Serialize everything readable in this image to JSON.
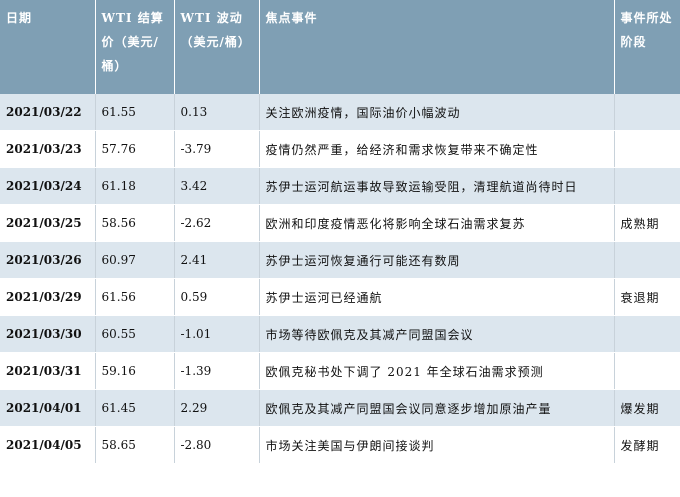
{
  "table": {
    "headers": [
      "日期",
      "WTI 结算价（美元/桶）",
      "WTI 波动（美元/桶）",
      "焦点事件",
      "事件所处阶段"
    ],
    "rows": [
      {
        "date": "2021/03/22",
        "price": "61.55",
        "change": "0.13",
        "event": "关注欧洲疫情，国际油价小幅波动",
        "phase": ""
      },
      {
        "date": "2021/03/23",
        "price": "57.76",
        "change": "-3.79",
        "event": "疫情仍然严重，给经济和需求恢复带来不确定性",
        "phase": ""
      },
      {
        "date": "2021/03/24",
        "price": "61.18",
        "change": "3.42",
        "event": "苏伊士运河航运事故导致运输受阻，清理航道尚待时日",
        "phase": ""
      },
      {
        "date": "2021/03/25",
        "price": "58.56",
        "change": "-2.62",
        "event": "欧洲和印度疫情恶化将影响全球石油需求复苏",
        "phase": "成熟期"
      },
      {
        "date": "2021/03/26",
        "price": "60.97",
        "change": "2.41",
        "event": "苏伊士运河恢复通行可能还有数周",
        "phase": ""
      },
      {
        "date": "2021/03/29",
        "price": "61.56",
        "change": "0.59",
        "event": "苏伊士运河已经通航",
        "phase": "衰退期"
      },
      {
        "date": "2021/03/30",
        "price": "60.55",
        "change": "-1.01",
        "event": "市场等待欧佩克及其减产同盟国会议",
        "phase": ""
      },
      {
        "date": "2021/03/31",
        "price": "59.16",
        "change": "-1.39",
        "event": "欧佩克秘书处下调了 2021 年全球石油需求预测",
        "phase": ""
      },
      {
        "date": "2021/04/01",
        "price": "61.45",
        "change": "2.29",
        "event": "欧佩克及其减产同盟国会议同意逐步增加原油产量",
        "phase": "爆发期"
      },
      {
        "date": "2021/04/05",
        "price": "58.65",
        "change": "-2.80",
        "event": "市场关注美国与伊朗间接谈判",
        "phase": "发酵期"
      }
    ]
  }
}
